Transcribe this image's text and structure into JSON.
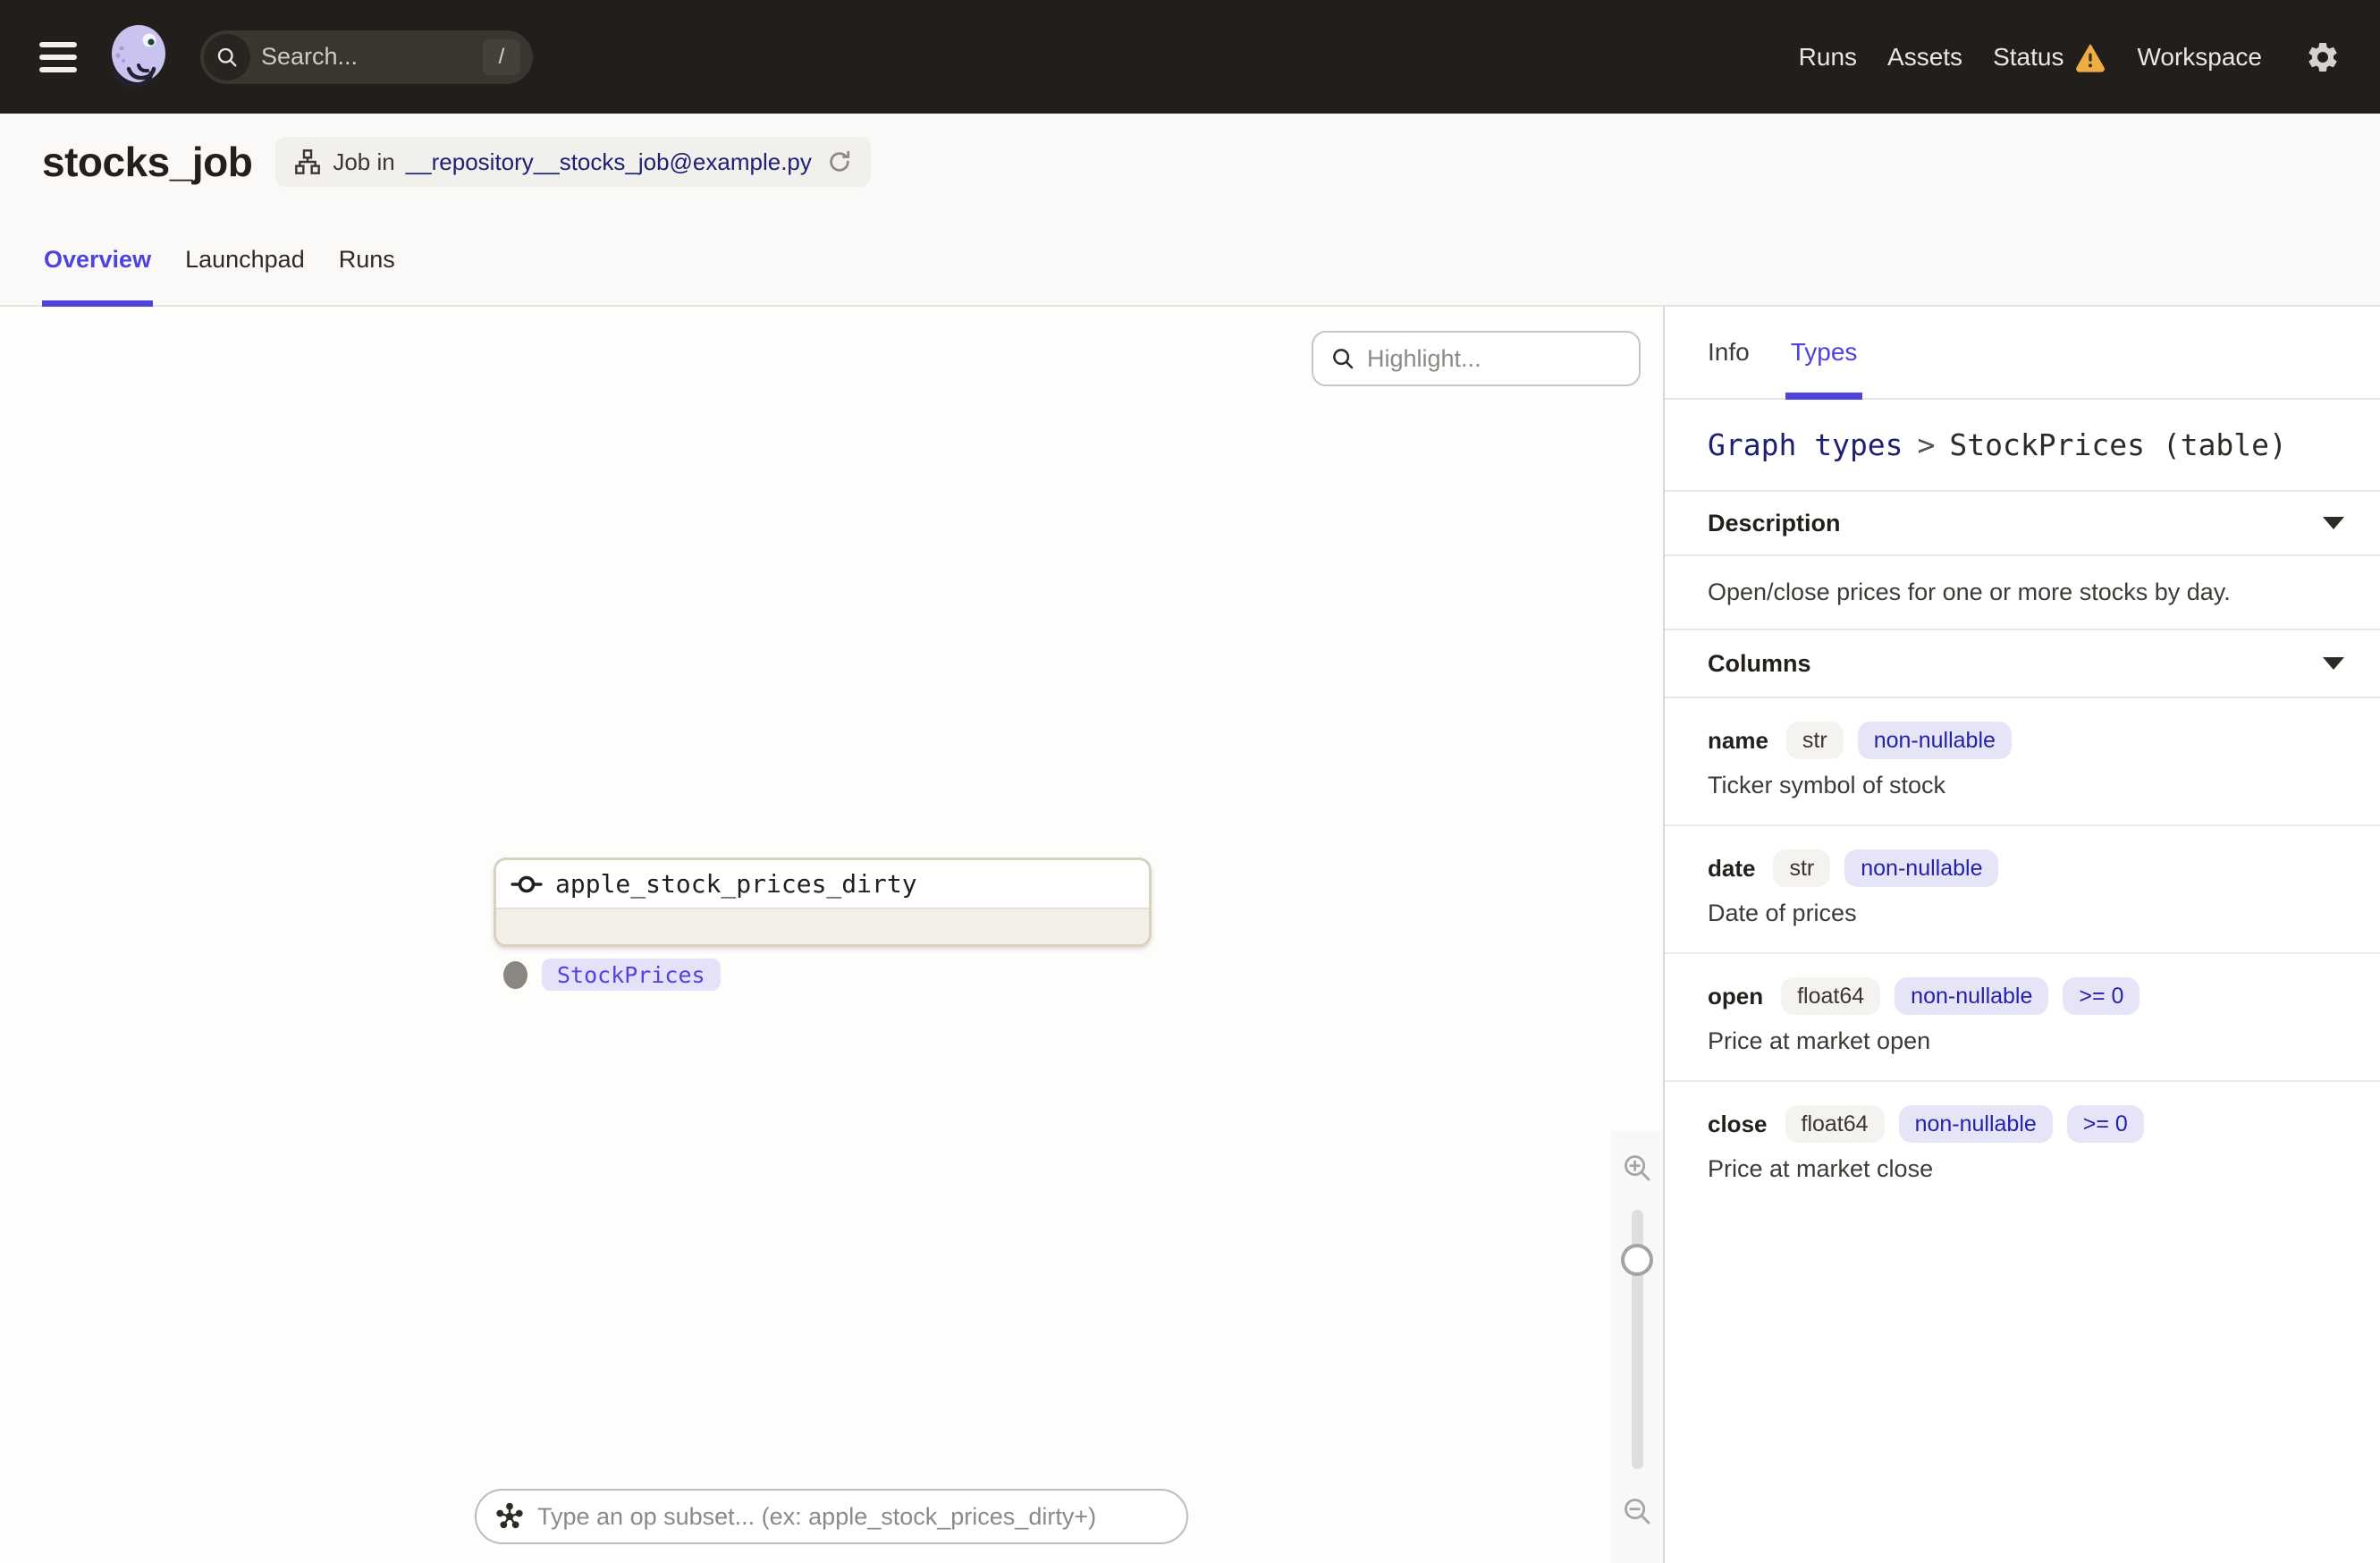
{
  "nav": {
    "search": {
      "placeholder": "Search...",
      "shortcut": "/"
    },
    "items": [
      "Runs",
      "Assets",
      "Status",
      "Workspace"
    ]
  },
  "header": {
    "title": "stocks_job",
    "job_badge": {
      "prefix": "Job in",
      "target": "__repository__stocks_job@example.py"
    },
    "tabs": [
      "Overview",
      "Launchpad",
      "Runs"
    ],
    "active_tab": "Overview"
  },
  "canvas": {
    "highlight": {
      "placeholder": "Highlight..."
    },
    "node": {
      "name": "apple_stock_prices_dirty",
      "output_type": "StockPrices"
    },
    "op_subset": {
      "placeholder": "Type an op subset... (ex: apple_stock_prices_dirty+)"
    }
  },
  "panel": {
    "tabs": [
      "Info",
      "Types"
    ],
    "active_tab": "Types",
    "breadcrumb": {
      "parent": "Graph types",
      "separator": ">",
      "current": "StockPrices (table)"
    },
    "description_section": {
      "title": "Description",
      "body": "Open/close prices for one or more stocks by day."
    },
    "columns_section": {
      "title": "Columns",
      "columns": [
        {
          "name": "name",
          "type": "str",
          "constraints": [
            "non-nullable"
          ],
          "description": "Ticker symbol of stock"
        },
        {
          "name": "date",
          "type": "str",
          "constraints": [
            "non-nullable"
          ],
          "description": "Date of prices"
        },
        {
          "name": "open",
          "type": "float64",
          "constraints": [
            "non-nullable",
            ">= 0"
          ],
          "description": "Price at market open"
        },
        {
          "name": "close",
          "type": "float64",
          "constraints": [
            "non-nullable",
            ">= 0"
          ],
          "description": "Price at market close"
        }
      ]
    }
  },
  "colors": {
    "accent_blurple": "#4F43DD",
    "link_navy": "#1E2172",
    "warning_amber": "#EFAC44",
    "node_border_tan": "#D9D1C0",
    "topnav_bg": "#211E1B"
  }
}
